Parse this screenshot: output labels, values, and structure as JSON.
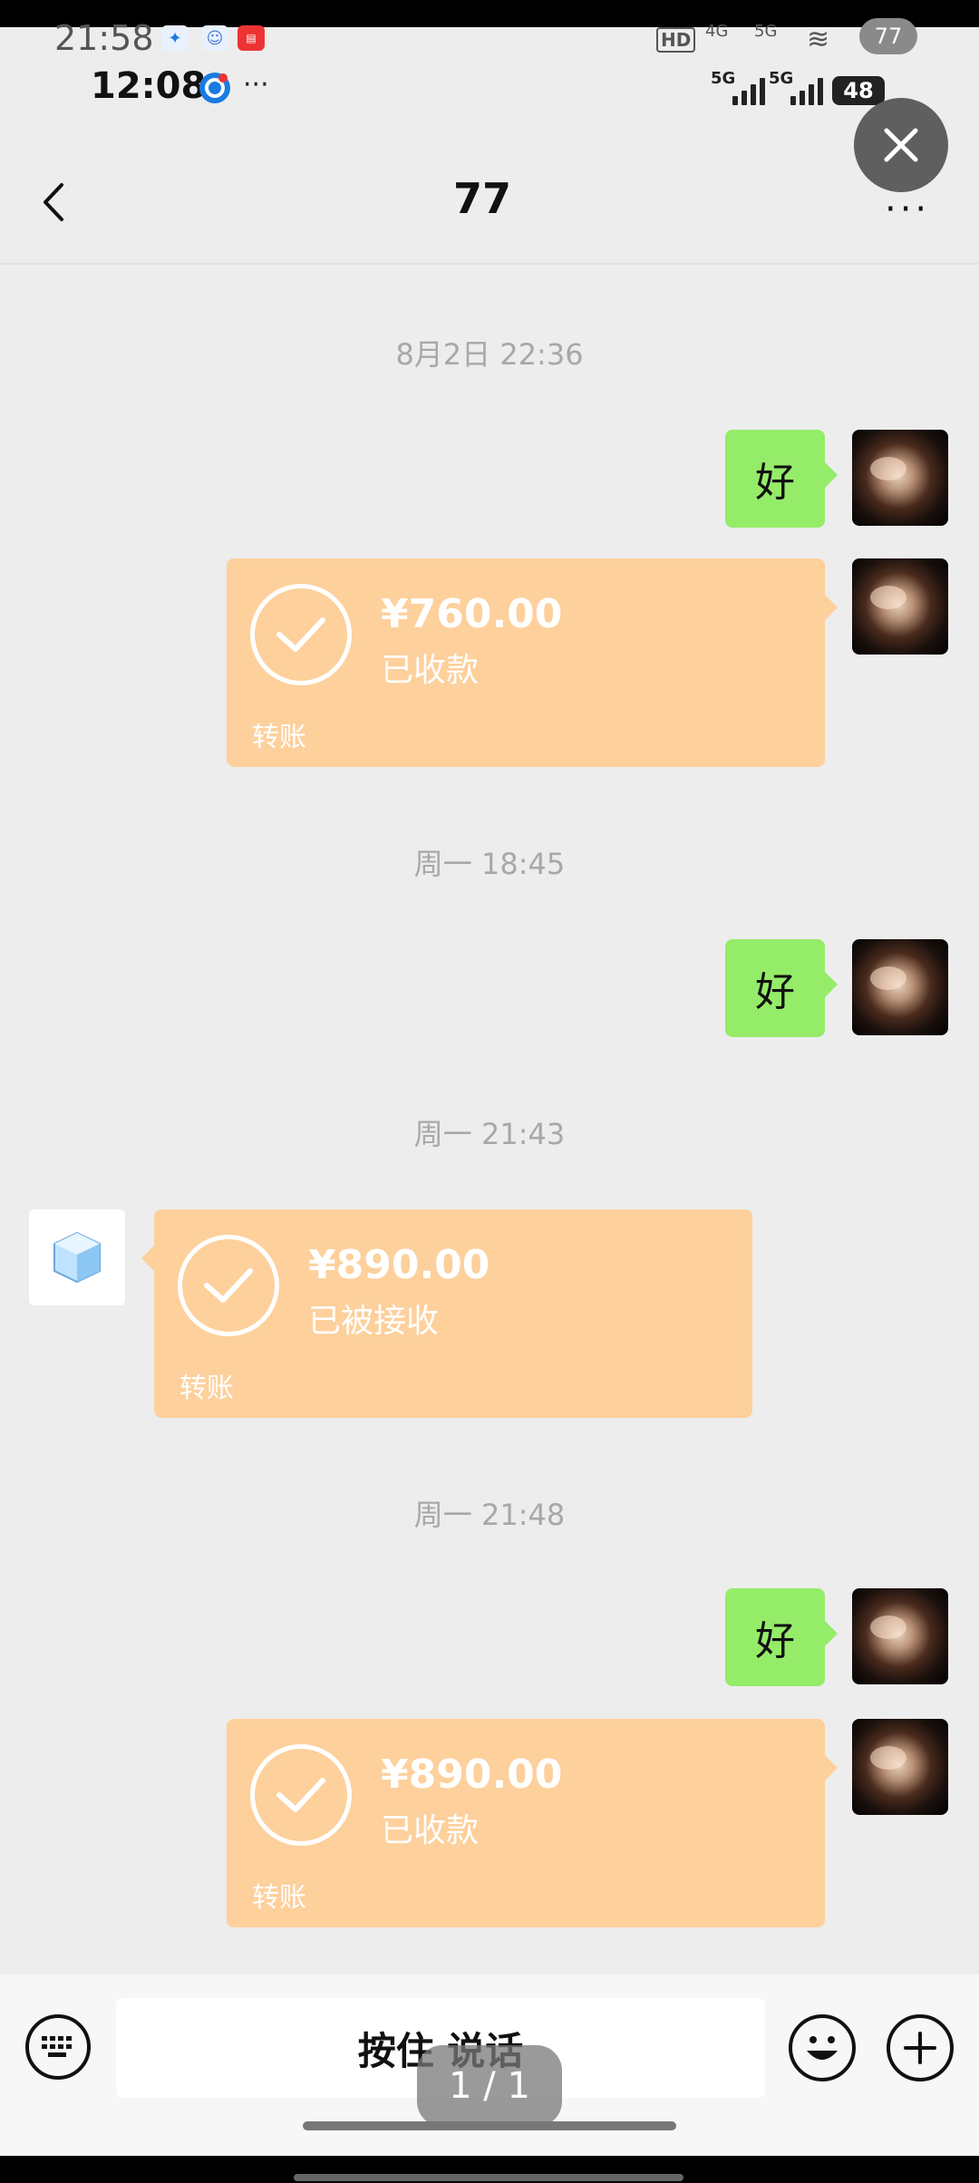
{
  "outer_status": {
    "time": "21:58",
    "badge": "77",
    "icons": [
      "bird-icon",
      "cat-icon",
      "news-icon"
    ]
  },
  "status_bar": {
    "time": "12:08",
    "more": "···",
    "network1": "5G",
    "network2": "5G",
    "battery": "48",
    "outer_hd": "HD",
    "outer_net1": "4G",
    "outer_net2": "5G"
  },
  "header": {
    "title": "77",
    "more": "···"
  },
  "messages": [
    {
      "type": "timestamp",
      "text": "8月2日 22:36"
    },
    {
      "type": "text",
      "side": "right",
      "text": "好"
    },
    {
      "type": "transfer",
      "side": "right",
      "amount": "¥760.00",
      "status": "已收款",
      "label": "转账"
    },
    {
      "type": "timestamp",
      "text": "周一 18:45"
    },
    {
      "type": "text",
      "side": "right",
      "text": "好"
    },
    {
      "type": "timestamp",
      "text": "周一 21:43"
    },
    {
      "type": "transfer",
      "side": "left",
      "amount": "¥890.00",
      "status": "已被接收",
      "label": "转账"
    },
    {
      "type": "timestamp",
      "text": "周一 21:48"
    },
    {
      "type": "text",
      "side": "right",
      "text": "好"
    },
    {
      "type": "transfer",
      "side": "right",
      "amount": "¥890.00",
      "status": "已收款",
      "label": "转账"
    }
  ],
  "input_bar": {
    "voice_label": "按住 说话"
  },
  "page_indicator": "1 / 1",
  "colors": {
    "text_bubble": "#95ec69",
    "transfer_card": "#fdd09c",
    "background": "#ededed"
  }
}
